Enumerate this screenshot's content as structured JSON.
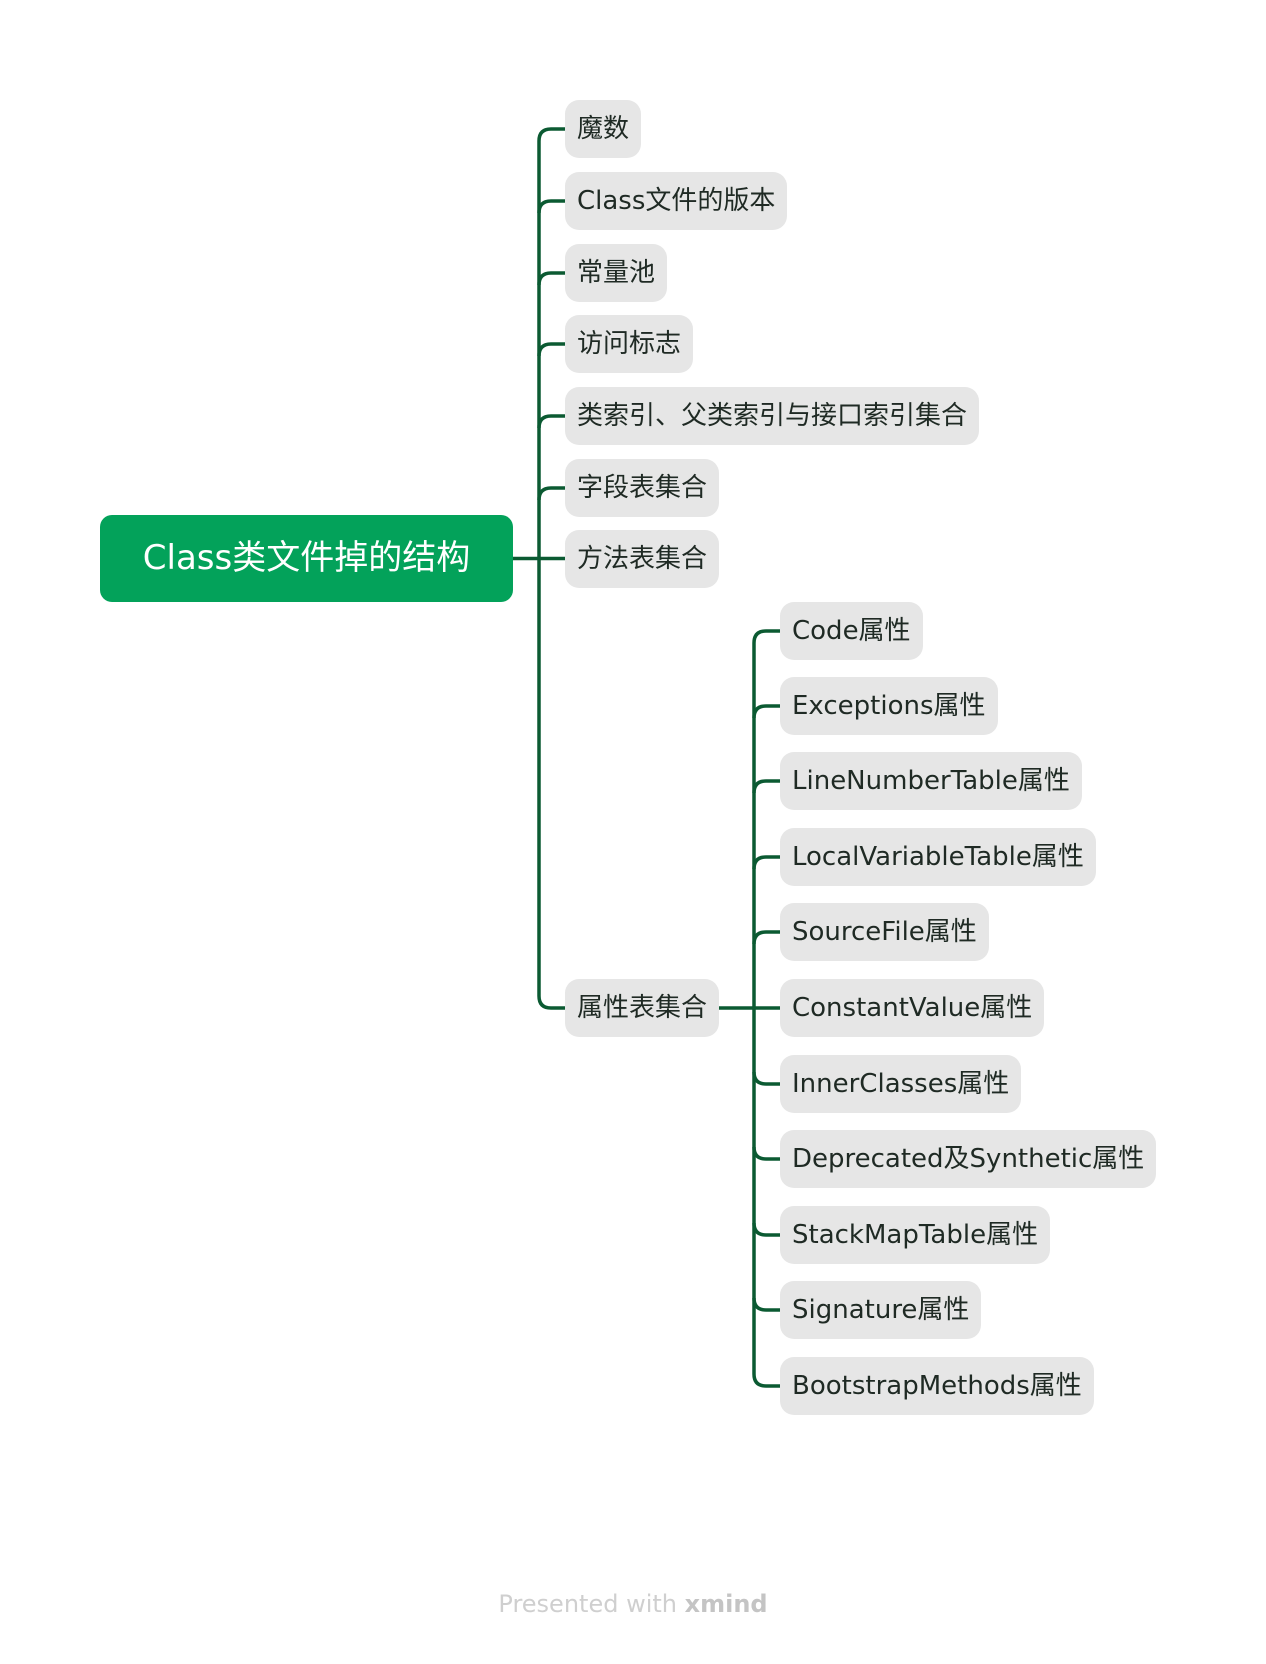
{
  "root": {
    "label": "Class类文件掉的结构",
    "color": "#03a25a"
  },
  "line_color": "#0b5a32",
  "node_color": "#e6e6e6",
  "level1": [
    {
      "label": "魔数"
    },
    {
      "label": "Class文件的版本"
    },
    {
      "label": "常量池"
    },
    {
      "label": "访问标志"
    },
    {
      "label": "类索引、父类索引与接口索引集合"
    },
    {
      "label": "字段表集合"
    },
    {
      "label": "方法表集合"
    },
    {
      "label": "属性表集合"
    }
  ],
  "level2": [
    {
      "label": "Code属性"
    },
    {
      "label": "Exceptions属性"
    },
    {
      "label": "LineNumberTable属性"
    },
    {
      "label": "LocalVariableTable属性"
    },
    {
      "label": "SourceFile属性"
    },
    {
      "label": "ConstantValue属性"
    },
    {
      "label": "InnerClasses属性"
    },
    {
      "label": "Deprecated及Synthetic属性"
    },
    {
      "label": "StackMapTable属性"
    },
    {
      "label": "Signature属性"
    },
    {
      "label": "BootstrapMethods属性"
    }
  ],
  "footer": {
    "prefix": "Presented with ",
    "brand": "xmind"
  }
}
